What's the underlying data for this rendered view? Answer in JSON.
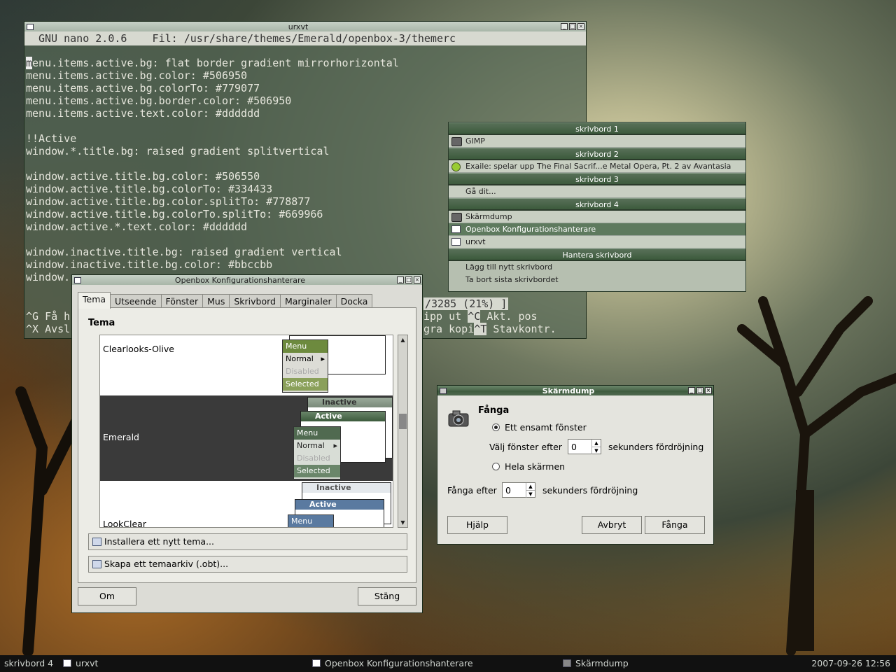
{
  "colors": {
    "accent": "#506a50",
    "menu_bg": "#c8cfc2",
    "selected_bg": "#5e7a5e",
    "taskbar_bg": "#111111"
  },
  "urxvt": {
    "title": "urxvt",
    "nano_header": "GNU nano 2.0.6    Fil: /usr/share/themes/Emerald/openbox-3/themerc",
    "lines": [
      "menu.items.active.bg: flat border gradient mirrorhorizontal",
      "menu.items.active.bg.color: #506950",
      "menu.items.active.bg.colorTo: #779077",
      "menu.items.active.bg.border.color: #506950",
      "menu.items.active.text.color: #dddddd",
      "",
      "!!Active",
      "window.*.title.bg: raised gradient splitvertical",
      "",
      "window.active.title.bg.color: #506550",
      "window.active.title.bg.colorTo: #334433",
      "window.active.title.bg.color.splitTo: #778877",
      "window.active.title.bg.colorTo.splitTo: #669966",
      "window.active.*.text.color: #dddddd",
      "",
      "window.inactive.title.bg: raised gradient vertical",
      "window.inactive.title.bg.color: #bbccbb",
      "window."
    ],
    "status_fragment": "/3285 (21%) ]",
    "shortcut_row1_left": "^G Få h",
    "shortcut_row2_left": "^X Avsl",
    "shortcut_row1_mid": "ipp ut",
    "shortcut_row2_mid": "gra kopi",
    "shortcut_row1_key": "^C",
    "shortcut_row1_label": "Akt. pos",
    "shortcut_row2_key": "^T",
    "shortcut_row2_label": "Stavkontr."
  },
  "rootmenu": {
    "sections": [
      {
        "header": "skrivbord 1",
        "items": [
          {
            "label": "GIMP",
            "icon": "gimp-icon"
          }
        ]
      },
      {
        "header": "skrivbord 2",
        "items": [
          {
            "label": "Exaile: spelar upp The Final Sacrif...e Metal Opera, Pt. 2 av Avantasia",
            "icon": "exaile-icon"
          }
        ]
      },
      {
        "header": "skrivbord 3",
        "items": [
          {
            "label": "Gå dit...",
            "icon": ""
          }
        ]
      },
      {
        "header": "skrivbord 4",
        "items": [
          {
            "label": "Skärmdump",
            "icon": "camera-icon"
          },
          {
            "label": "Openbox Konfigurationshanterare",
            "icon": "window-icon"
          },
          {
            "label": "urxvt",
            "icon": "terminal-icon"
          }
        ]
      },
      {
        "header": "Hantera skrivbord",
        "items": [
          {
            "label": "Lägg till nytt skrivbord",
            "icon": ""
          },
          {
            "label": "Ta bort sista skrivbordet",
            "icon": ""
          }
        ]
      }
    ]
  },
  "obconf": {
    "title": "Openbox Konfigurationshanterare",
    "tabs": [
      "Tema",
      "Utseende",
      "Fönster",
      "Mus",
      "Skrivbord",
      "Marginaler",
      "Docka"
    ],
    "section_title": "Tema",
    "themes": [
      "Clearlooks-Olive",
      "Emerald",
      "LookClear"
    ],
    "preview": {
      "menu": "Menu",
      "normal": "Normal",
      "disabled": "Disabled",
      "selected": "Selected",
      "inactive": "Inactive",
      "active": "Active"
    },
    "install_button": "Installera ett nytt tema...",
    "archive_button": "Skapa ett temaarkiv (.obt)...",
    "about_button": "Om",
    "close_button": "Stäng"
  },
  "skarm": {
    "title": "Skärmdump",
    "heading": "Fånga",
    "option_window": "Ett ensamt fönster",
    "delay_window_label": "Välj fönster efter",
    "delay_window_value": "0",
    "delay_suffix": "sekunders fördröjning",
    "option_screen": "Hela skärmen",
    "capture_after_label": "Fånga efter",
    "capture_after_value": "0",
    "help_button": "Hjälp",
    "cancel_button": "Avbryt",
    "capture_button": "Fånga"
  },
  "taskbar": {
    "desktop": "skrivbord 4",
    "tasks": [
      "urxvt",
      "Openbox Konfigurationshanterare",
      "Skärmdump"
    ],
    "clock": "2007-09-26 12:56"
  }
}
